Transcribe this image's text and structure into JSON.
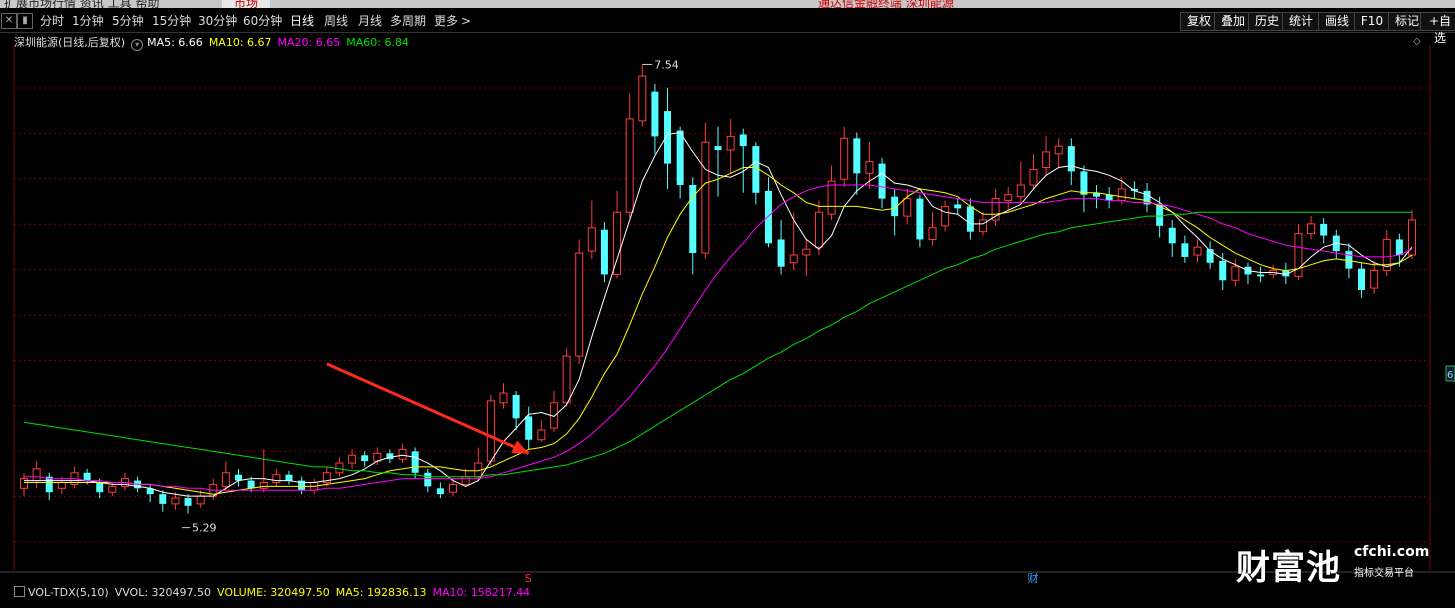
{
  "topbar": {
    "menu": "扩展市场行情    资讯    工具    帮助",
    "tab": "市场",
    "title": "通达信金融终端  深圳能源"
  },
  "periodbar": {
    "left_icons": [
      "close-icon",
      "panel-icon"
    ],
    "items": [
      "分时",
      "1分钟",
      "5分钟",
      "15分钟",
      "30分钟",
      "60分钟",
      "日线",
      "周线",
      "月线",
      "多周期",
      "更多"
    ],
    "active": "日线",
    "right_buttons": [
      "复权",
      "叠加",
      "历史",
      "统计",
      "画线",
      "F10",
      "标记",
      "+自选"
    ]
  },
  "legend": {
    "title": "深圳能源(日线,后复权)",
    "ma5": "MA5: 6.66",
    "ma10": "MA10: 6.67",
    "ma20": "MA20: 6.65",
    "ma60": "MA60: 6.84"
  },
  "volume_legend": {
    "name": "VOL-TDX(5,10)",
    "vvol": "VVOL: 320497.50",
    "volume": "VOLUME: 320497.50",
    "ma5": "MA5: 192836.13",
    "ma10": "MA10: 158217.44"
  },
  "watermark": {
    "cn": "财富池",
    "url": "cfchi.com",
    "sub": "指标交易平台"
  },
  "right_axis_fragment": "6",
  "colors": {
    "up": "#ff3b3b",
    "down": "#54ffff",
    "ma5": "#ffffff",
    "ma10": "#ffff00",
    "ma20": "#ff00ff",
    "ma60": "#00e000",
    "arrow": "#ff2a1a",
    "grid": "#7a0000"
  },
  "chart_data": {
    "type": "candlestick",
    "ylim": [
      5.0,
      7.7
    ],
    "grid": "horizontal dashed",
    "annotations": {
      "high_label": "7.54",
      "low_label": "5.29",
      "marker_s": "S",
      "marker_cai": "财"
    },
    "arrow": {
      "from": [
        24,
        6.06
      ],
      "to": [
        40,
        5.6
      ],
      "color": "#ff2a1a"
    },
    "candles": [
      [
        5.42,
        5.47,
        5.5,
        5.38
      ],
      [
        5.46,
        5.52,
        5.56,
        5.42
      ],
      [
        5.48,
        5.4,
        5.5,
        5.36
      ],
      [
        5.42,
        5.45,
        5.48,
        5.39
      ],
      [
        5.44,
        5.5,
        5.53,
        5.42
      ],
      [
        5.5,
        5.46,
        5.52,
        5.44
      ],
      [
        5.45,
        5.4,
        5.47,
        5.37
      ],
      [
        5.4,
        5.43,
        5.45,
        5.38
      ],
      [
        5.43,
        5.47,
        5.5,
        5.41
      ],
      [
        5.46,
        5.42,
        5.48,
        5.4
      ],
      [
        5.42,
        5.39,
        5.44,
        5.35
      ],
      [
        5.39,
        5.34,
        5.41,
        5.3
      ],
      [
        5.34,
        5.37,
        5.4,
        5.31
      ],
      [
        5.37,
        5.33,
        5.39,
        5.29
      ],
      [
        5.34,
        5.38,
        5.41,
        5.32
      ],
      [
        5.38,
        5.44,
        5.47,
        5.36
      ],
      [
        5.43,
        5.5,
        5.56,
        5.41
      ],
      [
        5.49,
        5.46,
        5.52,
        5.43
      ],
      [
        5.46,
        5.42,
        5.48,
        5.4
      ],
      [
        5.42,
        5.45,
        5.62,
        5.4
      ],
      [
        5.45,
        5.49,
        5.52,
        5.43
      ],
      [
        5.49,
        5.46,
        5.51,
        5.44
      ],
      [
        5.46,
        5.41,
        5.48,
        5.39
      ],
      [
        5.41,
        5.45,
        5.47,
        5.39
      ],
      [
        5.45,
        5.5,
        5.53,
        5.43
      ],
      [
        5.5,
        5.55,
        5.58,
        5.48
      ],
      [
        5.55,
        5.59,
        5.62,
        5.52
      ],
      [
        5.59,
        5.56,
        5.61,
        5.53
      ],
      [
        5.56,
        5.6,
        5.63,
        5.54
      ],
      [
        5.6,
        5.57,
        5.62,
        5.55
      ],
      [
        5.57,
        5.62,
        5.65,
        5.55
      ],
      [
        5.61,
        5.5,
        5.63,
        5.47
      ],
      [
        5.5,
        5.43,
        5.52,
        5.4
      ],
      [
        5.42,
        5.39,
        5.45,
        5.37
      ],
      [
        5.4,
        5.44,
        5.47,
        5.38
      ],
      [
        5.44,
        5.48,
        5.52,
        5.43
      ],
      [
        5.48,
        5.55,
        5.63,
        5.46
      ],
      [
        5.56,
        5.87,
        5.9,
        5.54
      ],
      [
        5.86,
        5.91,
        5.96,
        5.83
      ],
      [
        5.9,
        5.78,
        5.92,
        5.72
      ],
      [
        5.79,
        5.67,
        5.84,
        5.62
      ],
      [
        5.67,
        5.72,
        5.77,
        5.66
      ],
      [
        5.73,
        5.86,
        5.92,
        5.71
      ],
      [
        5.86,
        6.1,
        6.14,
        5.84
      ],
      [
        6.1,
        6.63,
        6.7,
        6.06
      ],
      [
        6.64,
        6.76,
        6.9,
        6.6
      ],
      [
        6.75,
        6.52,
        6.79,
        6.48
      ],
      [
        6.52,
        6.84,
        6.95,
        6.5
      ],
      [
        6.84,
        7.32,
        7.45,
        6.81
      ],
      [
        7.31,
        7.54,
        7.6,
        7.28
      ],
      [
        7.46,
        7.23,
        7.5,
        7.14
      ],
      [
        7.36,
        7.09,
        7.48,
        6.96
      ],
      [
        7.26,
        6.98,
        7.28,
        6.91
      ],
      [
        6.98,
        6.63,
        7.02,
        6.52
      ],
      [
        6.63,
        7.2,
        7.3,
        6.6
      ],
      [
        7.18,
        7.16,
        7.28,
        6.92
      ],
      [
        7.16,
        7.23,
        7.32,
        7.04
      ],
      [
        7.24,
        7.18,
        7.27,
        6.94
      ],
      [
        7.18,
        6.94,
        7.2,
        6.88
      ],
      [
        6.95,
        6.68,
        7.02,
        6.66
      ],
      [
        6.7,
        6.56,
        6.8,
        6.52
      ],
      [
        6.58,
        6.62,
        6.84,
        6.54
      ],
      [
        6.62,
        6.65,
        6.7,
        6.51
      ],
      [
        6.66,
        6.84,
        6.9,
        6.62
      ],
      [
        6.83,
        7.0,
        7.08,
        6.8
      ],
      [
        7.01,
        7.22,
        7.28,
        6.97
      ],
      [
        7.22,
        7.04,
        7.25,
        6.93
      ],
      [
        7.04,
        7.1,
        7.2,
        6.96
      ],
      [
        7.09,
        6.91,
        7.12,
        6.86
      ],
      [
        6.92,
        6.82,
        6.96,
        6.72
      ],
      [
        6.82,
        6.91,
        6.96,
        6.78
      ],
      [
        6.91,
        6.7,
        6.93,
        6.66
      ],
      [
        6.7,
        6.76,
        6.84,
        6.67
      ],
      [
        6.77,
        6.87,
        6.9,
        6.74
      ],
      [
        6.88,
        6.86,
        6.91,
        6.83
      ],
      [
        6.87,
        6.74,
        6.91,
        6.7
      ],
      [
        6.74,
        6.8,
        6.84,
        6.72
      ],
      [
        6.8,
        6.91,
        6.96,
        6.77
      ],
      [
        6.9,
        6.93,
        6.97,
        6.85
      ],
      [
        6.92,
        6.98,
        7.1,
        6.88
      ],
      [
        6.98,
        7.06,
        7.14,
        6.96
      ],
      [
        7.07,
        7.15,
        7.23,
        7.03
      ],
      [
        7.14,
        7.18,
        7.22,
        7.07
      ],
      [
        7.18,
        7.05,
        7.22,
        6.98
      ],
      [
        7.05,
        6.93,
        7.08,
        6.84
      ],
      [
        6.94,
        6.92,
        6.98,
        6.86
      ],
      [
        6.93,
        6.9,
        6.97,
        6.86
      ],
      [
        6.9,
        6.96,
        7.02,
        6.88
      ],
      [
        6.96,
        6.95,
        7.0,
        6.91
      ],
      [
        6.95,
        6.88,
        6.99,
        6.84
      ],
      [
        6.88,
        6.77,
        6.92,
        6.71
      ],
      [
        6.76,
        6.68,
        6.8,
        6.61
      ],
      [
        6.68,
        6.61,
        6.72,
        6.58
      ],
      [
        6.62,
        6.66,
        6.7,
        6.58
      ],
      [
        6.65,
        6.58,
        6.69,
        6.55
      ],
      [
        6.59,
        6.49,
        6.63,
        6.44
      ],
      [
        6.49,
        6.56,
        6.6,
        6.46
      ],
      [
        6.56,
        6.52,
        6.58,
        6.47
      ],
      [
        6.52,
        6.51,
        6.56,
        6.48
      ],
      [
        6.52,
        6.54,
        6.57,
        6.5
      ],
      [
        6.54,
        6.51,
        6.58,
        6.47
      ],
      [
        6.51,
        6.73,
        6.78,
        6.49
      ],
      [
        6.73,
        6.78,
        6.82,
        6.7
      ],
      [
        6.78,
        6.72,
        6.81,
        6.68
      ],
      [
        6.72,
        6.64,
        6.75,
        6.6
      ],
      [
        6.64,
        6.55,
        6.68,
        6.5
      ],
      [
        6.55,
        6.44,
        6.58,
        6.4
      ],
      [
        6.45,
        6.54,
        6.59,
        6.42
      ],
      [
        6.54,
        6.7,
        6.75,
        6.51
      ],
      [
        6.7,
        6.62,
        6.73,
        6.56
      ],
      [
        6.62,
        6.8,
        6.85,
        6.6
      ]
    ],
    "ma_lines": {
      "MA5": [
        5.46,
        5.46,
        5.46,
        5.46,
        5.46,
        5.46,
        5.45,
        5.44,
        5.44,
        5.43,
        5.42,
        5.4,
        5.39,
        5.38,
        5.38,
        5.38,
        5.42,
        5.46,
        5.47,
        5.47,
        5.46,
        5.46,
        5.45,
        5.45,
        5.46,
        5.47,
        5.49,
        5.52,
        5.56,
        5.58,
        5.59,
        5.58,
        5.55,
        5.51,
        5.46,
        5.43,
        5.46,
        5.56,
        5.66,
        5.73,
        5.8,
        5.81,
        5.79,
        5.85,
        5.98,
        6.2,
        6.4,
        6.6,
        6.8,
        7.0,
        7.13,
        7.24,
        7.25,
        7.15,
        7.06,
        7.03,
        7.02,
        7.05,
        7.1,
        7.07,
        6.93,
        6.8,
        6.7,
        6.65,
        6.72,
        6.87,
        6.95,
        7.0,
        7.04,
        6.99,
        6.98,
        6.96,
        6.87,
        6.84,
        6.83,
        6.78,
        6.78,
        6.82,
        6.85,
        6.88,
        6.96,
        7.03,
        7.07,
        7.08,
        7.06,
        7.05,
        7.03,
        7.0,
        6.95,
        6.93,
        6.89,
        6.84,
        6.77,
        6.71,
        6.64,
        6.6,
        6.57,
        6.54,
        6.53,
        6.53,
        6.52,
        6.55,
        6.61,
        6.66,
        6.68,
        6.67,
        6.62,
        6.58,
        6.56,
        6.58,
        6.66
      ],
      "MA10": [
        5.45,
        5.45,
        5.45,
        5.45,
        5.45,
        5.45,
        5.45,
        5.45,
        5.45,
        5.44,
        5.44,
        5.43,
        5.42,
        5.41,
        5.4,
        5.39,
        5.4,
        5.41,
        5.42,
        5.43,
        5.43,
        5.43,
        5.43,
        5.43,
        5.44,
        5.45,
        5.46,
        5.47,
        5.49,
        5.51,
        5.52,
        5.53,
        5.53,
        5.53,
        5.52,
        5.51,
        5.51,
        5.53,
        5.56,
        5.59,
        5.62,
        5.63,
        5.65,
        5.7,
        5.78,
        5.89,
        6.01,
        6.11,
        6.26,
        6.42,
        6.56,
        6.71,
        6.83,
        6.92,
        6.99,
        7.01,
        7.04,
        7.07,
        7.07,
        7.03,
        6.98,
        6.94,
        6.89,
        6.87,
        6.87,
        6.87,
        6.87,
        6.86,
        6.85,
        6.86,
        6.92,
        6.96,
        6.95,
        6.94,
        6.92,
        6.87,
        6.83,
        6.83,
        6.84,
        6.86,
        6.88,
        6.91,
        6.93,
        6.95,
        6.94,
        6.94,
        6.93,
        6.92,
        6.91,
        6.9,
        6.87,
        6.84,
        6.8,
        6.76,
        6.71,
        6.67,
        6.63,
        6.6,
        6.57,
        6.55,
        6.54,
        6.55,
        6.57,
        6.59,
        6.6,
        6.59,
        6.58,
        6.57,
        6.57,
        6.58,
        6.62
      ],
      "MA20": [
        5.48,
        5.48,
        5.47,
        5.47,
        5.47,
        5.46,
        5.46,
        5.45,
        5.45,
        5.44,
        5.44,
        5.43,
        5.43,
        5.42,
        5.42,
        5.41,
        5.41,
        5.41,
        5.41,
        5.41,
        5.41,
        5.41,
        5.41,
        5.41,
        5.42,
        5.42,
        5.43,
        5.44,
        5.45,
        5.46,
        5.47,
        5.47,
        5.47,
        5.47,
        5.47,
        5.47,
        5.47,
        5.48,
        5.5,
        5.52,
        5.54,
        5.56,
        5.58,
        5.61,
        5.65,
        5.7,
        5.76,
        5.82,
        5.89,
        5.97,
        6.05,
        6.14,
        6.24,
        6.34,
        6.44,
        6.53,
        6.61,
        6.68,
        6.76,
        6.82,
        6.88,
        6.92,
        6.95,
        6.97,
        6.98,
        6.98,
        6.98,
        6.98,
        6.97,
        6.96,
        6.95,
        6.94,
        6.93,
        6.92,
        6.91,
        6.9,
        6.89,
        6.89,
        6.89,
        6.89,
        6.89,
        6.89,
        6.9,
        6.91,
        6.91,
        6.91,
        6.9,
        6.9,
        6.89,
        6.89,
        6.88,
        6.87,
        6.85,
        6.83,
        6.81,
        6.78,
        6.76,
        6.73,
        6.71,
        6.69,
        6.67,
        6.66,
        6.65,
        6.64,
        6.63,
        6.62,
        6.61,
        6.61,
        6.61,
        6.62,
        6.65
      ],
      "MA60": [
        5.76,
        5.75,
        5.74,
        5.73,
        5.72,
        5.71,
        5.7,
        5.69,
        5.68,
        5.67,
        5.66,
        5.65,
        5.64,
        5.63,
        5.62,
        5.61,
        5.6,
        5.59,
        5.58,
        5.57,
        5.56,
        5.55,
        5.54,
        5.53,
        5.53,
        5.52,
        5.51,
        5.51,
        5.5,
        5.5,
        5.49,
        5.49,
        5.48,
        5.48,
        5.48,
        5.48,
        5.48,
        5.49,
        5.49,
        5.5,
        5.51,
        5.52,
        5.53,
        5.54,
        5.56,
        5.58,
        5.6,
        5.63,
        5.66,
        5.7,
        5.74,
        5.78,
        5.82,
        5.86,
        5.9,
        5.94,
        5.98,
        6.01,
        6.05,
        6.09,
        6.12,
        6.16,
        6.19,
        6.23,
        6.26,
        6.3,
        6.33,
        6.37,
        6.4,
        6.43,
        6.46,
        6.49,
        6.52,
        6.55,
        6.57,
        6.6,
        6.62,
        6.65,
        6.67,
        6.69,
        6.71,
        6.73,
        6.74,
        6.76,
        6.77,
        6.78,
        6.79,
        6.8,
        6.81,
        6.82,
        6.82,
        6.83,
        6.83,
        6.84,
        6.84,
        6.84,
        6.84,
        6.84,
        6.84,
        6.84,
        6.84,
        6.84,
        6.84,
        6.84,
        6.84,
        6.84,
        6.84,
        6.84,
        6.84,
        6.84,
        6.84
      ]
    }
  }
}
